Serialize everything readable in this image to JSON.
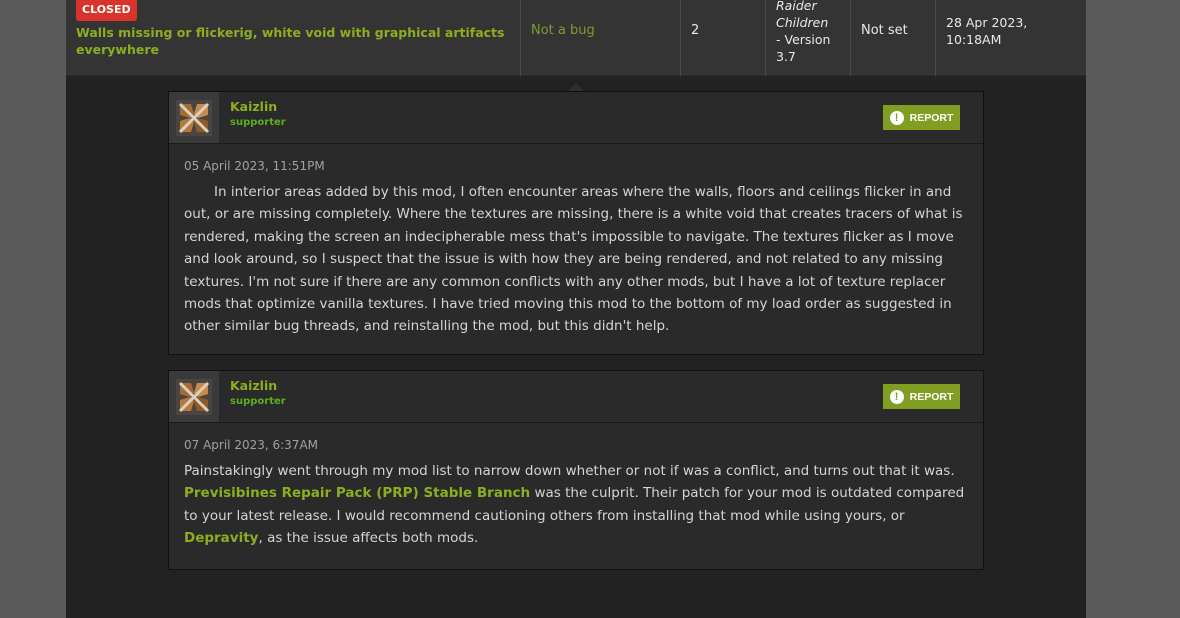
{
  "bug": {
    "badge": "CLOSED",
    "title": "Walls missing or flickerig, white void with graphical artifacts everywhere",
    "status": "Not a bug",
    "replies": "2",
    "version_italic_1": "Raider",
    "version_italic_2": "Children",
    "version_rest_1": "- Version",
    "version_rest_2": "3.7",
    "priority": "Not set",
    "date_line1": "28 Apr 2023,",
    "date_line2": "10:18AM",
    "colors": {
      "badge": "#d9342b",
      "title": "#8dae1f",
      "status": "#7d9c33"
    }
  },
  "comments": [
    {
      "author": "Kaizlin",
      "role": "supporter",
      "report_label": "REPORT",
      "date": "05 April 2023, 11:51PM",
      "text": "In interior areas added by this mod, I often encounter areas where the walls, floors and ceilings flicker in and out, or are missing completely. Where the textures are missing, there is a white void that creates tracers of what is rendered, making the screen an indecipherable mess that's impossible to navigate. The textures flicker as I move and look around, so I suspect that the issue is with how they are being rendered, and not related to any missing textures. I'm not sure if there are any common conflicts with any other mods, but I have a lot of texture replacer mods that optimize vanilla textures. I have tried moving this mod to the bottom of my load order as suggested in other similar bug threads, and reinstalling the mod, but this didn't help."
    },
    {
      "author": "Kaizlin",
      "role": "supporter",
      "report_label": "REPORT",
      "date": "07 April 2023, 6:37AM",
      "text_part1": "Painstakingly went through my mod list to narrow down whether or not if was a conflict, and turns out that it was. ",
      "link1": "Previsibines Repair Pack (PRP) Stable Branch",
      "text_part2": " was the culprit. Their patch for your mod is outdated compared to your latest release. I would recommend cautioning others from installing that mod while using yours, or ",
      "link2": "Depravity",
      "text_part3": ", as the issue affects both mods."
    }
  ],
  "icons": {
    "report": "exclamation-circle-icon",
    "avatar": "avatar-image"
  }
}
